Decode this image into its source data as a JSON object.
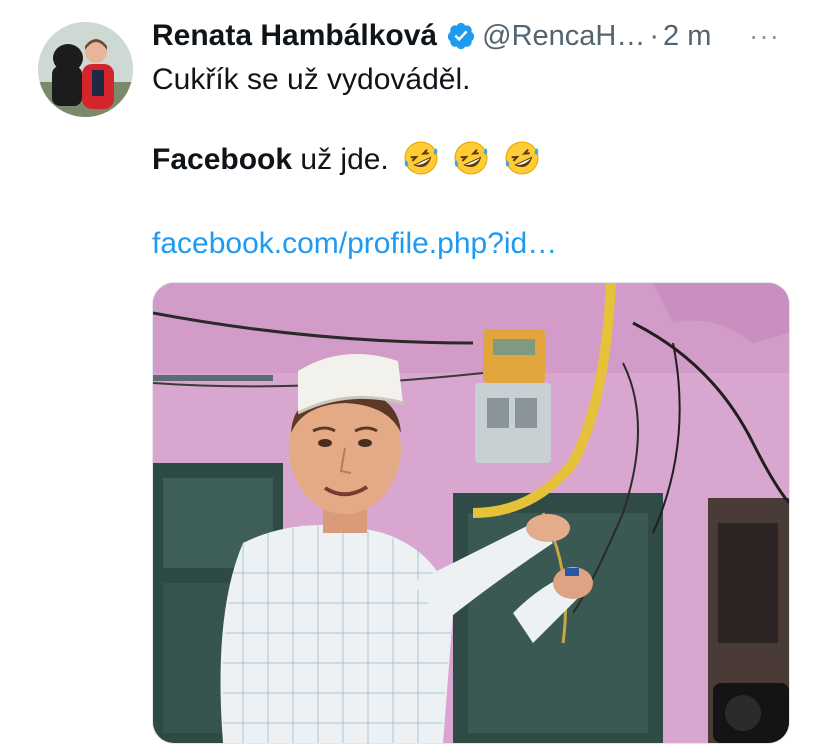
{
  "tweet": {
    "author_name": "Renata Hambálková",
    "handle": "@RencaH…",
    "separator": "·",
    "time": "2 m",
    "more_label": "···",
    "text_line1": "Cukřík se už vydováděl.",
    "text_bold": "Facebook",
    "text_rest": " už jde.",
    "link": "facebook.com/profile.php?id…"
  },
  "icons": {
    "verified": "verified-badge-icon",
    "emoji": "rolling-on-the-floor-laughing",
    "more": "more-options-icon"
  },
  "colors": {
    "text": "#0f1419",
    "secondary": "#536471",
    "link": "#1d9bf0",
    "verified": "#1d9bf0"
  }
}
